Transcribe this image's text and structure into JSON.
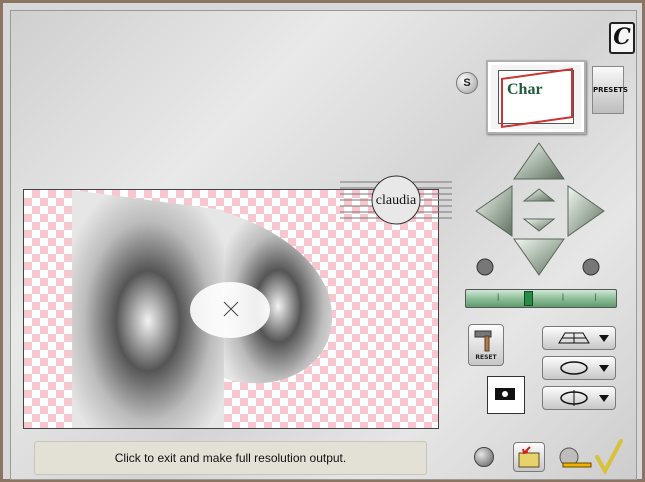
{
  "title_logo_text": "C",
  "thumb_text": "Char",
  "presets_label": "PRESETS",
  "s_button_label": "S",
  "reset_label": "RESET",
  "status_text": "Click to exit and make full resolution output.",
  "watermark_text": "claudia",
  "colors": {
    "frame": "#8c7463",
    "checker": "#f7c7cf",
    "slider_green": "#2b8a43"
  },
  "icons": [
    "c-logo-icon",
    "up-arrow-icon",
    "down-arrow-icon",
    "left-arrow-icon",
    "right-arrow-icon",
    "rotate-left-icon",
    "rotate-right-icon",
    "hammer-icon",
    "eye-icon",
    "grid-perspective-icon",
    "rotate-circle-icon",
    "flip-circle-icon",
    "grid-view-icon",
    "folder-export-icon",
    "hand-point-icon",
    "check-icon"
  ]
}
